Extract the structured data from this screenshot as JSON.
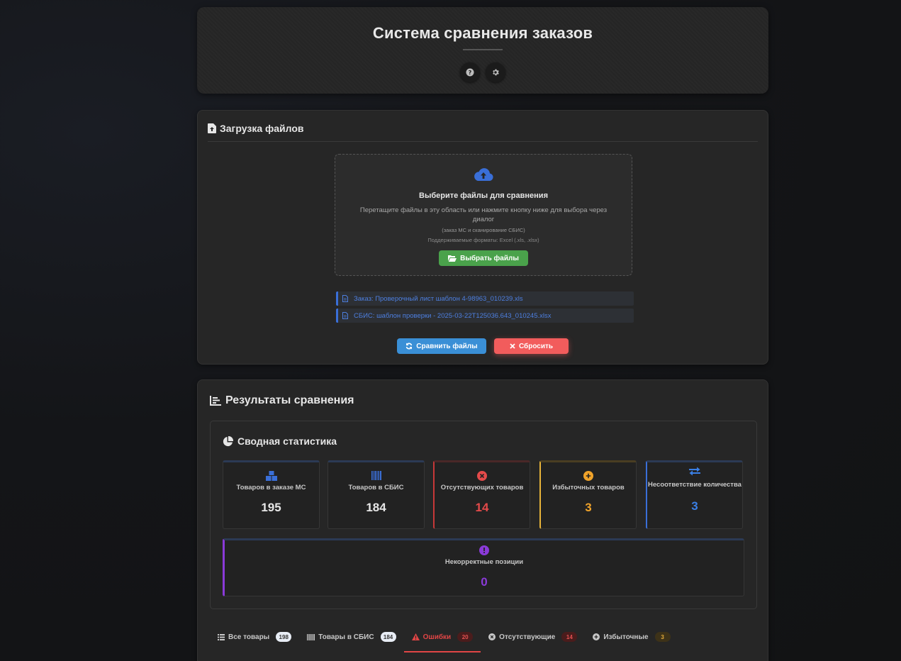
{
  "header": {
    "title": "Система сравнения заказов"
  },
  "upload": {
    "title": "Загрузка файлов",
    "dropzone_title": "Выберите файлы для сравнения",
    "dropzone_desc": "Перетащите файлы в эту область или нажмите кнопку ниже для выбора через диалог",
    "dropzone_note": "(заказ МС и сканирование СБИС)",
    "dropzone_formats": "Поддерживаемые форматы: Excel (.xls, .xlsx)",
    "choose_label": "Выбрать файлы",
    "files": [
      "Заказ: Проверочный лист шаблон 4-98963_010239.xls",
      "СБИС: шаблон проверки - 2025-03-22T125036.643_010245.xlsx"
    ],
    "compare_label": "Сравнить файлы",
    "reset_label": "Сбросить"
  },
  "results": {
    "title": "Результаты сравнения",
    "summary_title": "Сводная статистика",
    "cards": [
      {
        "label": "Товаров в заказе МС",
        "value": "195",
        "color": "#e6e6e6"
      },
      {
        "label": "Товаров в СБИС",
        "value": "184",
        "color": "#e6e6e6"
      },
      {
        "label": "Отсутствующих товаров",
        "value": "14",
        "color": "#e44a4a"
      },
      {
        "label": "Избыточных товаров",
        "value": "3",
        "color": "#f0a32a"
      },
      {
        "label": "Несоответствие количества",
        "value": "3",
        "color": "#3a7fe6"
      }
    ],
    "invalid_card": {
      "label": "Некорректные позиции",
      "value": "0",
      "color": "#8a3ad8"
    },
    "tabs": [
      {
        "label": "Все товары",
        "count": "198"
      },
      {
        "label": "Товары в СБИС",
        "count": "184"
      },
      {
        "label": "Ошибки",
        "count": "20"
      },
      {
        "label": "Отсутствующие",
        "count": "14"
      },
      {
        "label": "Избыточные",
        "count": "3"
      }
    ]
  },
  "colors": {
    "accent_blue": "#3a6fd8",
    "green": "#4aa24b",
    "red": "#f25c5c"
  }
}
